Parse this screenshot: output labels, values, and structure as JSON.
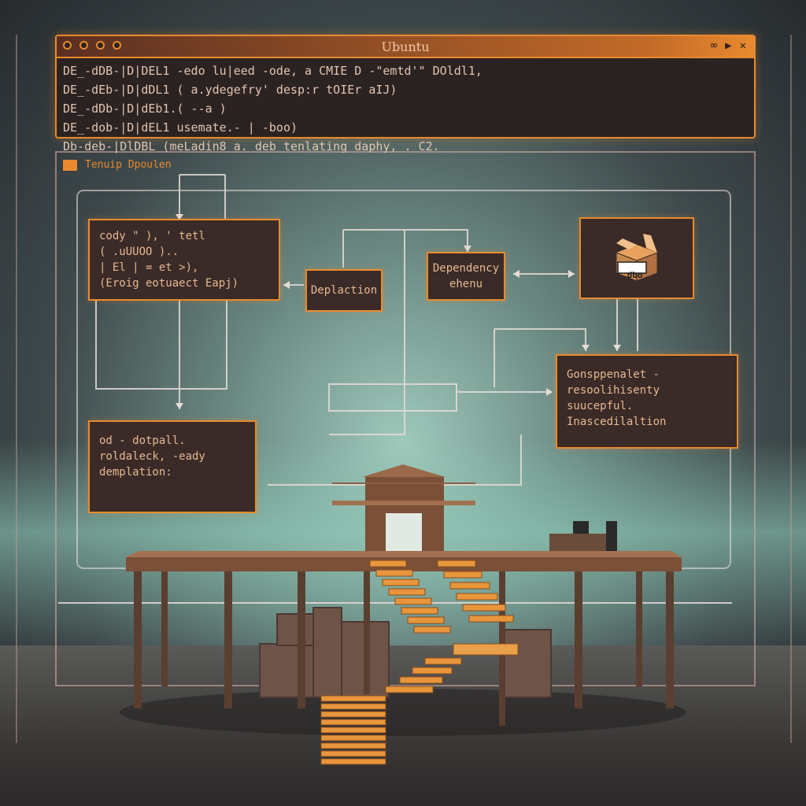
{
  "terminal": {
    "title": "Ubuntu",
    "lines": [
      "DE_-dDB-|D|DEL1 -edo lu|eed -ode, a CMIE D -\"emtd'\" DOldl1,",
      "DE_-dEb-|D|dDL1 ( a.ydegefry' desp:r tOIEr aIJ)",
      "DE_-dDb-|D|dEb1.( --a )",
      "DE_-dob-|D|dEL1 usemate.- | -boo)",
      "Db-deb-|DlDBL (meLadin8 a. deb tenlating daphy, . C2."
    ]
  },
  "panel": {
    "title": "Tenuip Dpoulen"
  },
  "nodes": {
    "code_block": [
      "cody \" ), ' tetl",
      "( .uUUOO )..",
      "|    El |  = et >),",
      "(Eroig eotuaect Eapj)"
    ],
    "deplaction": "Deplaction",
    "dependency": [
      "Dependency",
      "ehenu"
    ],
    "package_label": ".dbo",
    "resolution": [
      "Gonsppenalet -",
      "resoolihisenty",
      "suucepful.",
      "Inascedilaltion"
    ],
    "left_bottom": [
      "od - dotpall.",
      "roldaleck, -eady",
      "demplation:"
    ]
  },
  "colors": {
    "accent": "#e98a2e",
    "node_bg": "#3a2a28",
    "node_text": "#e7b98f"
  }
}
